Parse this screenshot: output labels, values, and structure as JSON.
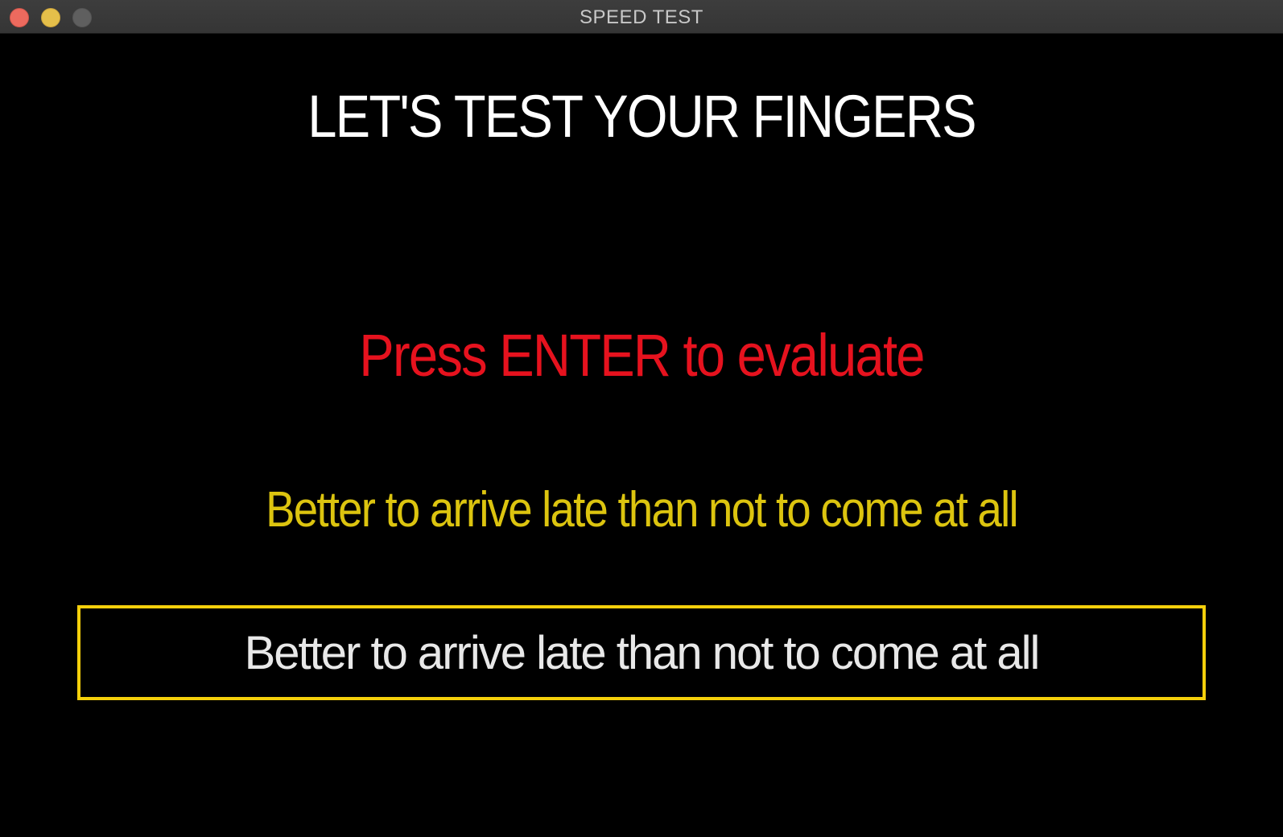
{
  "window": {
    "title": "SPEED TEST"
  },
  "main": {
    "heading": "LET'S TEST YOUR FINGERS",
    "prompt": "Press ENTER to evaluate",
    "target_sentence": "Better to arrive late than not to come at all",
    "typing_input_value": "Better to arrive late than not to come at all"
  },
  "colors": {
    "background": "#000000",
    "heading": "#ffffff",
    "prompt": "#e6121e",
    "target_sentence": "#dcc40f",
    "input_border": "#f5d00b",
    "input_text": "#e8e8e8"
  },
  "icons": {
    "close": "close-traffic-light",
    "minimize": "minimize-traffic-light",
    "zoom": "zoom-traffic-light"
  }
}
